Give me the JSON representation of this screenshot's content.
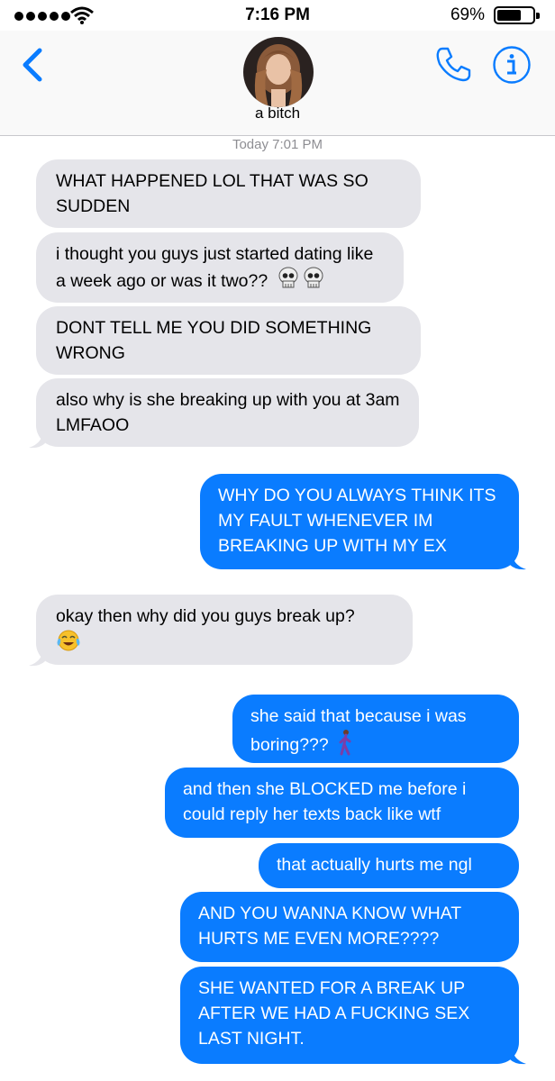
{
  "status_bar": {
    "time": "7:16 PM",
    "battery": "69%"
  },
  "header": {
    "contact_name": "a bitch"
  },
  "timestamp": "Today 7:01 PM",
  "messages": [
    {
      "dir": "in",
      "text": "WHAT HAPPENED LOL THAT WAS SO SUDDEN"
    },
    {
      "dir": "in",
      "text": "i thought you guys just started dating like a week ago or was it two??",
      "emoji": "skull skull"
    },
    {
      "dir": "in",
      "text": "DONT TELL ME YOU DID SOMETHING WRONG"
    },
    {
      "dir": "in",
      "text": "also why is she breaking up with you at 3am LMFAOO"
    },
    {
      "dir": "out",
      "text": "WHY DO YOU ALWAYS THINK ITS MY FAULT WHENEVER IM BREAKING UP WITH MY EX"
    },
    {
      "dir": "in",
      "text": "okay then why did you guys break up?",
      "emoji": "face-with-tears-of-joy"
    },
    {
      "dir": "out",
      "text": "she said that because i was boring???",
      "emoji": "person-walking"
    },
    {
      "dir": "out",
      "text": "and then she BLOCKED me before i could reply her texts back like wtf"
    },
    {
      "dir": "out",
      "text": "that actually hurts me ngl"
    },
    {
      "dir": "out",
      "text": "AND YOU WANNA KNOW WHAT HURTS ME EVEN MORE????"
    },
    {
      "dir": "out",
      "text": "SHE WANTED FOR A BREAK UP AFTER WE HAD A FUCKING SEX LAST NIGHT."
    }
  ],
  "colors": {
    "incoming": "#e5e5ea",
    "outgoing": "#0a7cff",
    "accent": "#0a7cff"
  },
  "icons": [
    "back-chevron-icon",
    "phone-icon",
    "info-icon",
    "signal-icon",
    "wifi-icon",
    "battery-icon"
  ]
}
